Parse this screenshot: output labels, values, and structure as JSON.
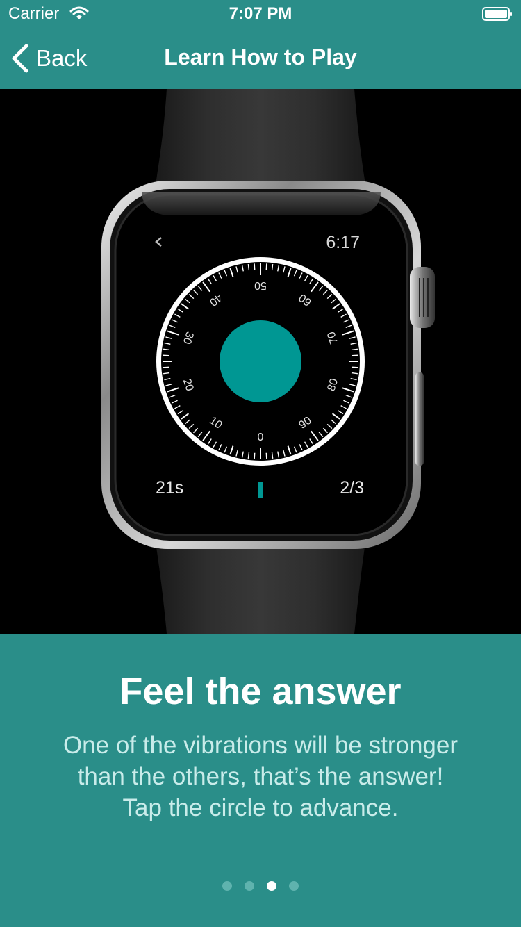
{
  "status_bar": {
    "carrier": "Carrier",
    "time": "7:07 PM"
  },
  "nav": {
    "back_label": "Back",
    "title": "Learn How to Play"
  },
  "watch": {
    "clock": "6:17",
    "timer": "21s",
    "progress": "2/3",
    "dial_labels": [
      "0",
      "10",
      "20",
      "30",
      "40",
      "50",
      "60",
      "70",
      "80",
      "90"
    ],
    "accent_color": "#009793"
  },
  "panel": {
    "title": "Feel the answer",
    "body_lines": [
      "One of the vibrations will be stronger",
      "than the others, that’s the answer!",
      "Tap the circle to advance."
    ]
  },
  "pager": {
    "count": 4,
    "active_index": 2
  },
  "colors": {
    "brand": "#2a8e89",
    "body_text": "#c9ecea"
  }
}
